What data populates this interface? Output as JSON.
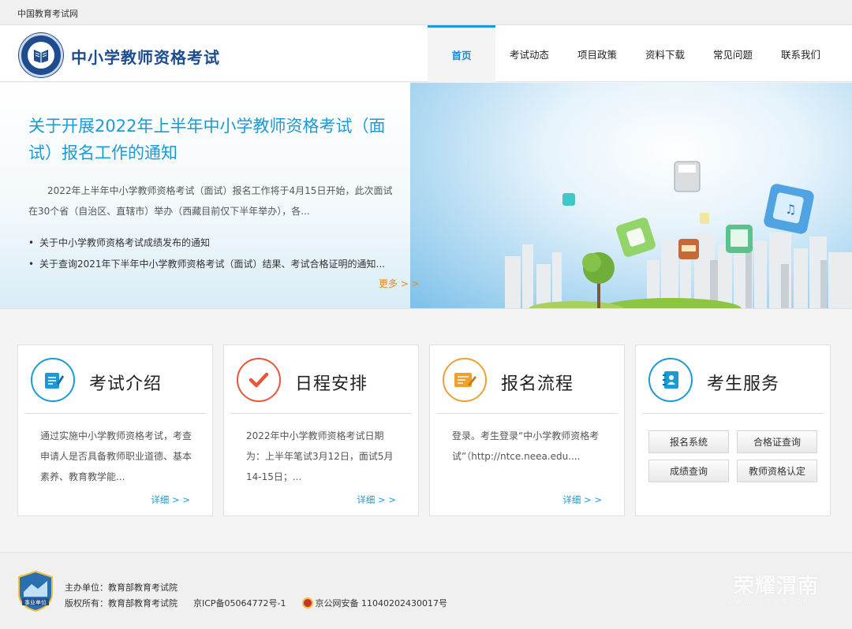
{
  "topbar": {
    "site_name": "中国教育考试网"
  },
  "header": {
    "title": "中小学教师资格考试",
    "nav": [
      {
        "label": "首页",
        "active": true
      },
      {
        "label": "考试动态"
      },
      {
        "label": "项目政策"
      },
      {
        "label": "资料下载"
      },
      {
        "label": "常见问题"
      },
      {
        "label": "联系我们"
      }
    ]
  },
  "banner": {
    "title": "关于开展2022年上半年中小学教师资格考试（面试）报名工作的通知",
    "summary": "2022年上半年中小学教师资格考试（面试）报名工作将于4月15日开始，此次面试在30个省（自治区、直辖市）举办（西藏目前仅下半年举办），各...",
    "news": [
      "关于中小学教师资格考试成绩发布的通知",
      "关于查询2021年下半年中小学教师资格考试（面试）结果、考试合格证明的通知..."
    ],
    "more": "更多 > >"
  },
  "cards": [
    {
      "title": "考试介绍",
      "text": "通过实施中小学教师资格考试，考查申请人是否具备教师职业道德、基本素养、教育教学能...",
      "more": "详细 > >",
      "color": "#1b9bd6"
    },
    {
      "title": "日程安排",
      "text": "2022年中小学教师资格考试日期为：上半年笔试3月12日，面试5月14-15日；...",
      "more": "详细 > >",
      "color": "#e8563a"
    },
    {
      "title": "报名流程",
      "text": "登录。考生登录“中小学教师资格考试”（http://ntce.neea.edu....",
      "more": "详细 > >",
      "color": "#f0a030"
    },
    {
      "title": "考生服务",
      "buttons": [
        "报名系统",
        "合格证查询",
        "成绩查询",
        "教师资格认定"
      ],
      "color": "#1b9bd6"
    }
  ],
  "footer": {
    "sponsor": "主办单位：教育部教育考试院",
    "copyright": "版权所有：教育部教育考试院",
    "icp": "京ICP备05064772号-1",
    "police": "京公网安备 11040202430017号",
    "badge": "事业单位",
    "watermark": "荣耀渭南",
    "watermark_sub": "WWW.YSWN.CN"
  }
}
